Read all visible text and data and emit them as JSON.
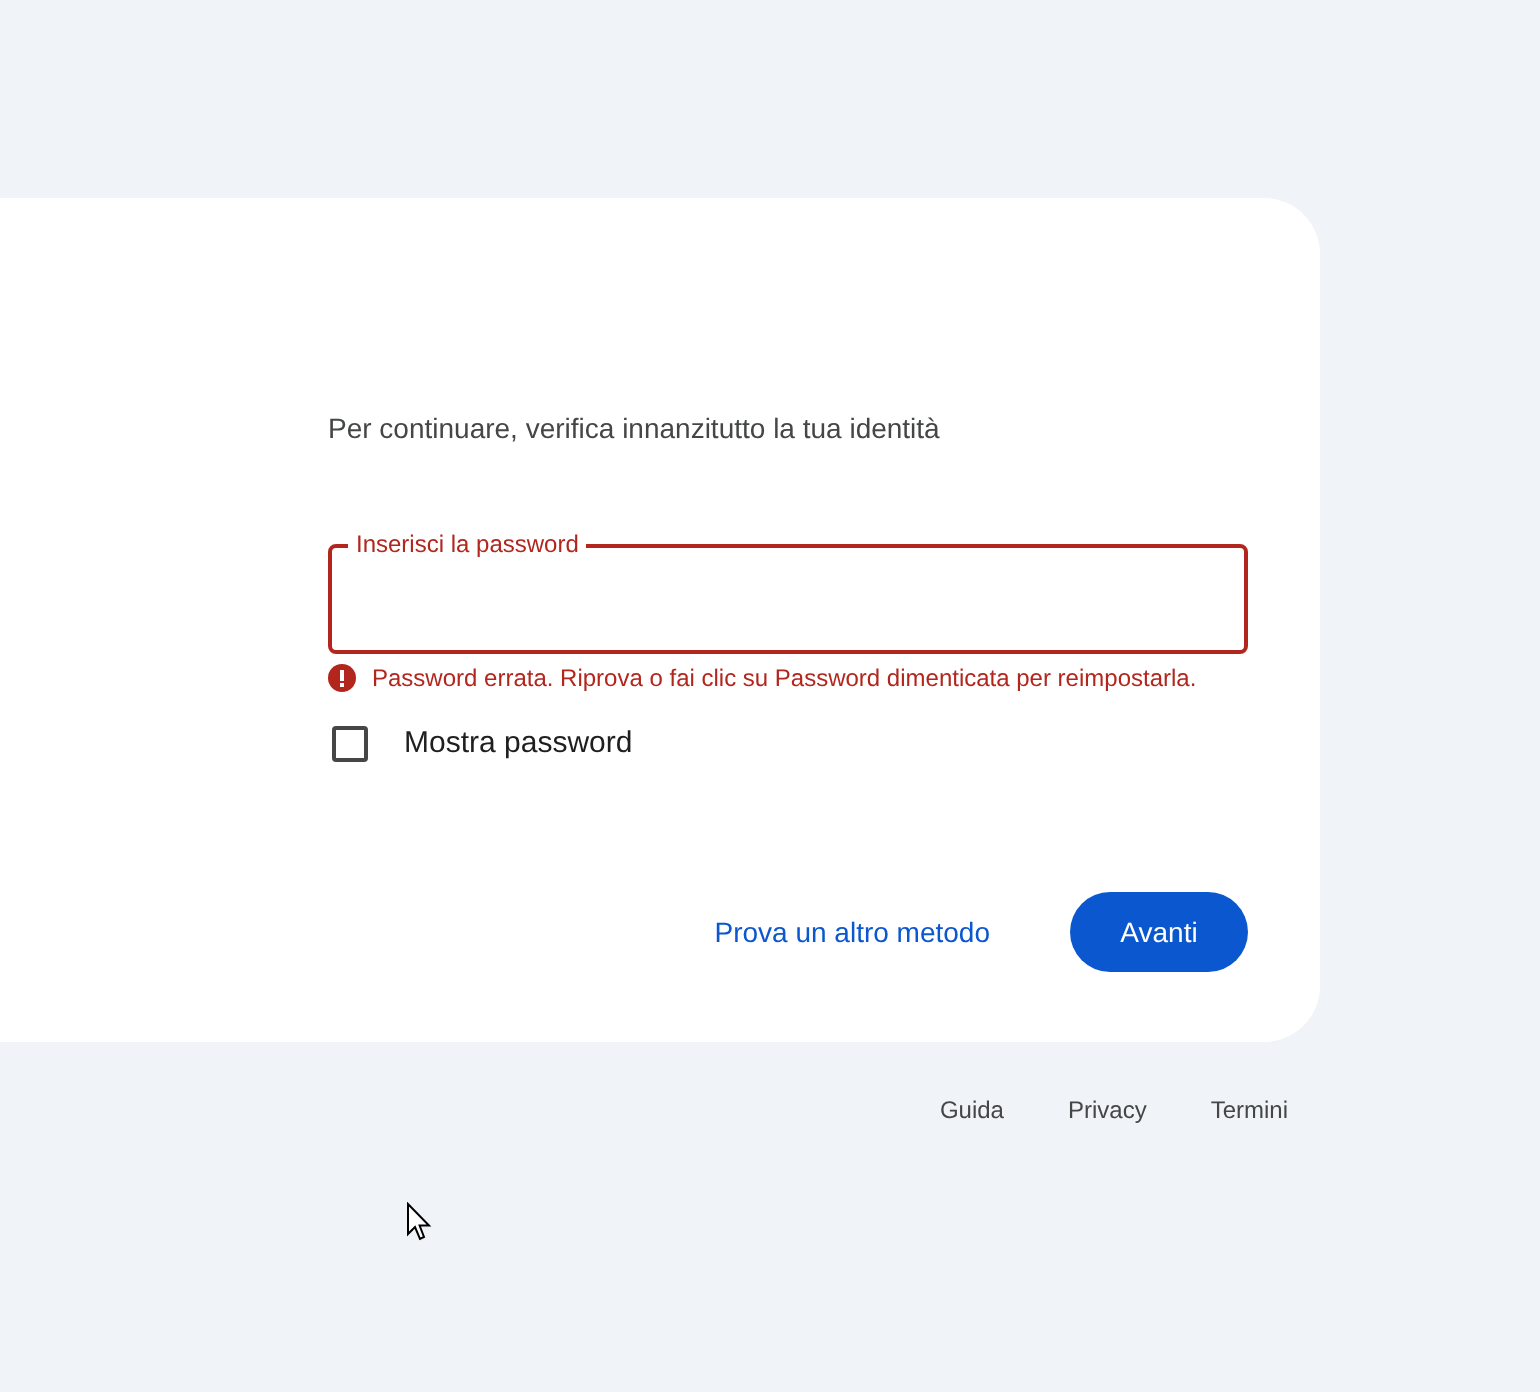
{
  "subtitle": "Per continuare, verifica innanzitutto la tua identità",
  "password_field": {
    "label": "Inserisci la password",
    "invalid": true,
    "error": "Password errata. Riprova o fai clic su Password dimenticata per reimpostarla."
  },
  "show_password": {
    "label": "Mostra password",
    "checked": false
  },
  "actions": {
    "link": "Prova un altro metodo",
    "primary": "Avanti"
  },
  "footer_links": [
    "Guida",
    "Privacy",
    "Termini"
  ]
}
